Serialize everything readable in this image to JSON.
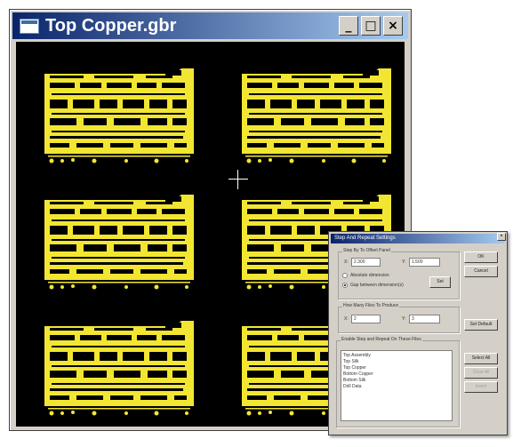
{
  "window": {
    "title": "Top Copper.gbr",
    "buttons": {
      "minimize": "_",
      "maximize": "□",
      "close": "×"
    }
  },
  "canvas": {
    "background": "#000000",
    "trace_color": "#f2e632",
    "boards": 6
  },
  "dialog": {
    "title": "Step And Repeat Settings",
    "close": "×",
    "group_step": {
      "label": "Step By To Offset Panel",
      "x_label": "X:",
      "x_value": "2.300",
      "y_label": "Y:",
      "y_value": "1.500",
      "radio_absolute": "Absolute dimension",
      "radio_gap": "Gap between dimension(s)",
      "set_label": "Set"
    },
    "group_repeat": {
      "label": "How Many Files To Produce",
      "x_label": "X:",
      "x_value": "2",
      "y_label": "Y:",
      "y_value": "3",
      "default_label": "Set Default"
    },
    "group_files": {
      "label": "Enable Step and Repeat On These Files",
      "items": [
        "Top Assembly",
        "Top Silk",
        "Top Copper",
        "Bottom Copper",
        "Bottom Silk",
        "Drill Data"
      ]
    },
    "buttons": {
      "ok": "OK",
      "cancel": "Cancel",
      "select_all": "Select All",
      "clear_all": "Clear All",
      "invert": "Invert"
    }
  }
}
